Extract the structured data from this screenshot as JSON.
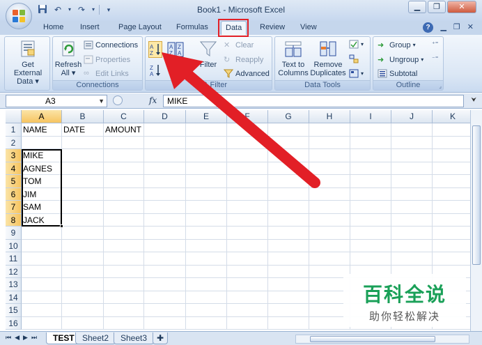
{
  "window": {
    "title": "Book1 - Microsoft Excel"
  },
  "tabs": [
    "Home",
    "Insert",
    "Page Layout",
    "Formulas",
    "Data",
    "Review",
    "View"
  ],
  "active_tab": "Data",
  "ribbon": {
    "get_external": {
      "line1": "Get External",
      "line2": "Data"
    },
    "connections_group": {
      "refresh_line1": "Refresh",
      "refresh_line2": "All",
      "connections": "Connections",
      "properties": "Properties",
      "edit_links": "Edit Links",
      "label": "Connections"
    },
    "sort_filter_group": {
      "filter": "Filter",
      "clear": "Clear",
      "reapply": "Reapply",
      "advanced": "Advanced",
      "label": "& Filter"
    },
    "data_tools_group": {
      "text_to_columns_line1": "Text to",
      "text_to_columns_line2": "Columns",
      "remove_duplicates_line1": "Remove",
      "remove_duplicates_line2": "Duplicates",
      "label": "Data Tools"
    },
    "outline_group": {
      "group": "Group",
      "ungroup": "Ungroup",
      "subtotal": "Subtotal",
      "label": "Outline"
    }
  },
  "formula_bar": {
    "name_box": "A3",
    "fx": "fx",
    "value": "MIKE"
  },
  "grid": {
    "columns": [
      "A",
      "B",
      "C",
      "D",
      "E",
      "F",
      "G",
      "H",
      "I",
      "J",
      "K"
    ],
    "rows": [
      "1",
      "2",
      "3",
      "4",
      "5",
      "6",
      "7",
      "8",
      "9",
      "10",
      "11",
      "12",
      "13",
      "14",
      "15",
      "16"
    ],
    "active_column": "A",
    "cells": {
      "A1": "NAME",
      "B1": "DATE",
      "C1": "AMOUNT",
      "A3": "MIKE",
      "A4": "AGNES",
      "A5": "TOM",
      "A6": "JIM",
      "A7": "SAM",
      "A8": "JACK"
    }
  },
  "sheets": [
    "TEST",
    "Sheet2",
    "Sheet3"
  ],
  "active_sheet": "TEST",
  "watermark": {
    "main": "百科全说",
    "sub": "助你轻松解决"
  },
  "colors": {
    "highlight_red": "#e21f26",
    "ribbon_bg": "#dbe7f5",
    "selection_header": "#f6c460"
  }
}
